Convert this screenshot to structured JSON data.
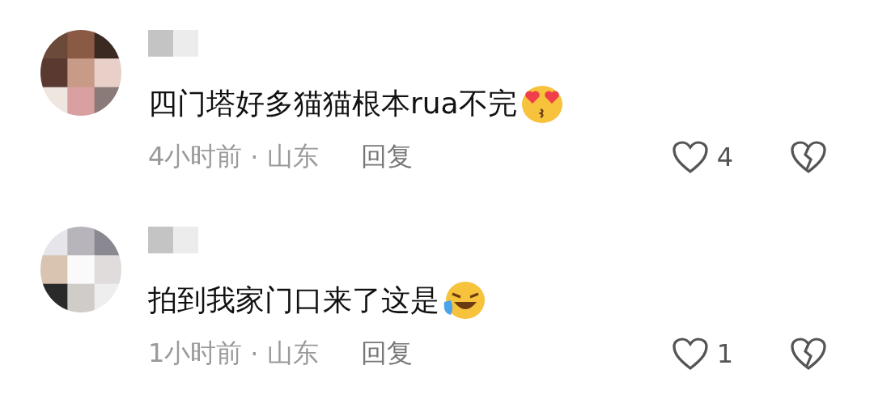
{
  "comments": [
    {
      "text": "四门塔好多猫猫根本rua不完",
      "emoji": {
        "kind": "heart_eyes"
      },
      "time": "4小时前",
      "separator": "·",
      "location": "山东",
      "reply": "回复",
      "likes": "4"
    },
    {
      "text": "拍到我家门口来了这是",
      "emoji": {
        "kind": "laughing"
      },
      "time": "1小时前",
      "separator": "·",
      "location": "山东",
      "reply": "回复",
      "likes": "1"
    }
  ]
}
